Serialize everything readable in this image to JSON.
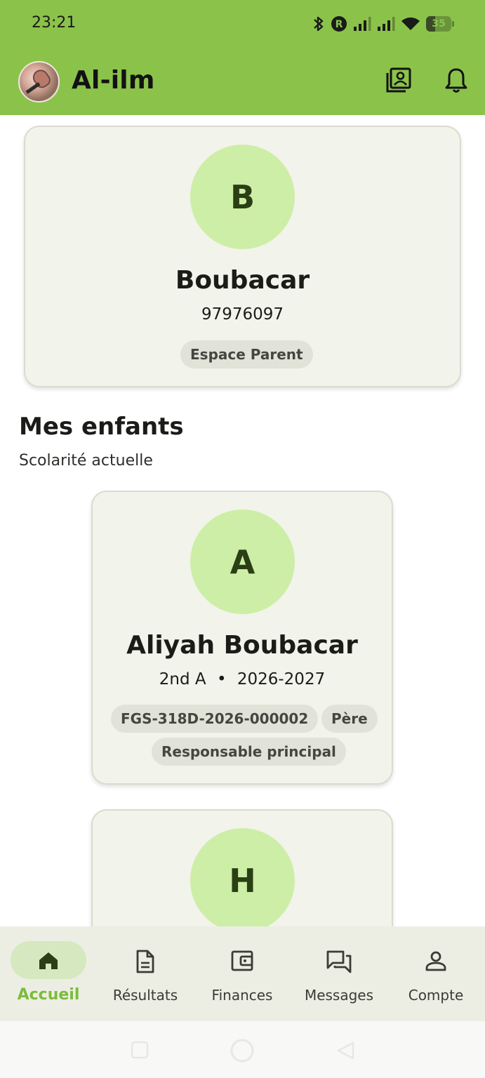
{
  "status_bar": {
    "time": "23:21",
    "battery": "35",
    "battery_level_percent": 35,
    "icons": [
      "bluetooth-icon",
      "roaming-r-icon",
      "signal-icon",
      "signal-icon",
      "wifi-icon",
      "battery-icon"
    ]
  },
  "app_bar": {
    "title": "Al-ilm",
    "actions": [
      "contact-card-icon",
      "bell-icon"
    ]
  },
  "parent_card": {
    "initial": "B",
    "name": "Boubacar",
    "phone": "97976097",
    "chip": "Espace Parent"
  },
  "children_section": {
    "title": "Mes enfants",
    "subtitle": "Scolarité actuelle"
  },
  "children": [
    {
      "initial": "A",
      "name": "Aliyah Boubacar",
      "class": "2nd A",
      "separator": "•",
      "year": "2026-2027",
      "chips": [
        "FGS-318D-2026-000002",
        "Père",
        "Responsable principal"
      ]
    },
    {
      "initial": "H"
    }
  ],
  "bottom_nav": {
    "items": [
      {
        "label": "Accueil",
        "icon": "home-icon",
        "active": true
      },
      {
        "label": "Résultats",
        "icon": "document-icon",
        "active": false
      },
      {
        "label": "Finances",
        "icon": "wallet-icon",
        "active": false
      },
      {
        "label": "Messages",
        "icon": "chat-icon",
        "active": false
      },
      {
        "label": "Compte",
        "icon": "person-icon",
        "active": false
      }
    ]
  },
  "colors": {
    "primary": "#8bc34a",
    "avatar_bg": "#cdeea6",
    "card_bg": "#f2f3ea",
    "active_nav": "#7cbc3a"
  }
}
